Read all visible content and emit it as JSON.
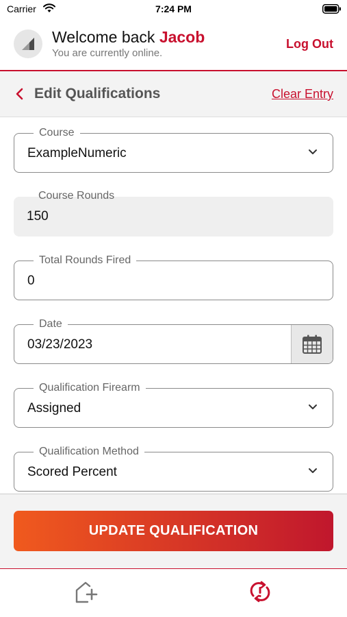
{
  "status_bar": {
    "carrier": "Carrier",
    "time": "7:24 PM",
    "icons": [
      "wifi-icon",
      "battery-icon"
    ]
  },
  "header": {
    "welcome_prefix": "Welcome back",
    "user_name": "Jacob",
    "online_status": "You are currently online.",
    "logout_label": "Log Out",
    "avatar_icon": "signal-triangle-icon"
  },
  "subheader": {
    "back_icon": "chevron-left-icon",
    "title": "Edit Qualifications",
    "clear_label": "Clear Entry"
  },
  "form": {
    "course": {
      "label": "Course",
      "value": "ExampleNumeric",
      "type": "dropdown"
    },
    "course_rounds": {
      "label": "Course Rounds",
      "value": "150",
      "disabled": true
    },
    "total_rounds_fired": {
      "label": "Total Rounds Fired",
      "value": "0"
    },
    "date": {
      "label": "Date",
      "value": "03/23/2023",
      "icon": "calendar-icon"
    },
    "qualification_firearm": {
      "label": "Qualification Firearm",
      "value": "Assigned",
      "type": "dropdown"
    },
    "qualification_method": {
      "label": "Qualification Method",
      "value": "Scored Percent",
      "type": "dropdown"
    }
  },
  "actions": {
    "update_label": "UPDATE QUALIFICATION"
  },
  "tabbar": {
    "items": [
      {
        "icon": "home-add-icon"
      },
      {
        "icon": "sync-alert-icon"
      }
    ]
  },
  "colors": {
    "brand_red": "#c8102e",
    "gradient_start": "#f05a1e",
    "gradient_end": "#c0172d",
    "panel_gray": "#f3f3f3",
    "disabled_field": "#efefef"
  }
}
